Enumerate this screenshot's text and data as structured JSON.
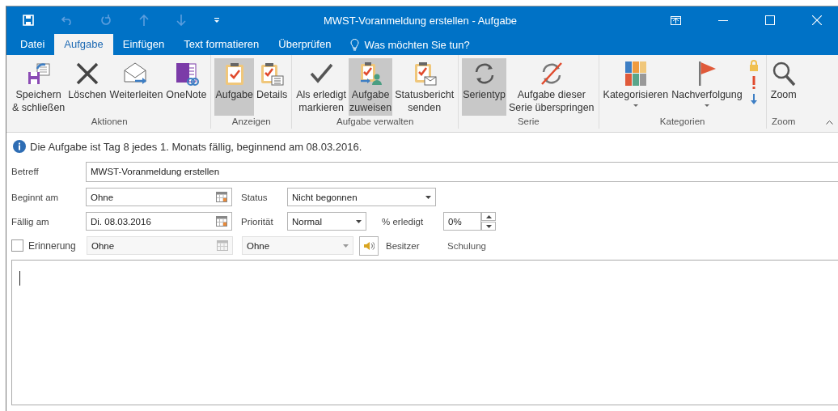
{
  "window": {
    "title": "MWST-Voranmeldung erstellen - Aufgabe"
  },
  "tabs": [
    {
      "label": "Datei",
      "selected": false
    },
    {
      "label": "Aufgabe",
      "selected": true
    },
    {
      "label": "Einfügen",
      "selected": false
    },
    {
      "label": "Text formatieren",
      "selected": false
    },
    {
      "label": "Überprüfen",
      "selected": false
    }
  ],
  "tell_me": "Was möchten Sie tun?",
  "ribbon": {
    "groups": [
      {
        "label": "Aktionen",
        "buttons": [
          {
            "lines": [
              "Speichern",
              "& schließen"
            ],
            "selected": false
          },
          {
            "lines": [
              "Löschen"
            ],
            "selected": false
          },
          {
            "lines": [
              "Weiterleiten"
            ],
            "selected": false
          },
          {
            "lines": [
              "OneNote"
            ],
            "selected": false
          }
        ]
      },
      {
        "label": "Anzeigen",
        "buttons": [
          {
            "lines": [
              "Aufgabe"
            ],
            "selected": true
          },
          {
            "lines": [
              "Details"
            ],
            "selected": false
          }
        ]
      },
      {
        "label": "Aufgabe verwalten",
        "buttons": [
          {
            "lines": [
              "Als erledigt",
              "markieren"
            ],
            "selected": false
          },
          {
            "lines": [
              "Aufgabe",
              "zuweisen"
            ],
            "selected": true
          },
          {
            "lines": [
              "Statusbericht",
              "senden"
            ],
            "selected": false
          }
        ]
      },
      {
        "label": "Serie",
        "buttons": [
          {
            "lines": [
              "Serientyp"
            ],
            "selected": true
          },
          {
            "lines": [
              "Aufgabe dieser",
              "Serie überspringen"
            ],
            "selected": false
          }
        ]
      },
      {
        "label": "Kategorien",
        "buttons": [
          {
            "lines": [
              "Kategorisieren"
            ],
            "selected": false,
            "dropdown": true
          },
          {
            "lines": [
              "Nachverfolgung"
            ],
            "selected": false,
            "dropdown": true
          }
        ]
      },
      {
        "label": "Zoom",
        "buttons": [
          {
            "lines": [
              "Zoom"
            ],
            "selected": false
          }
        ]
      }
    ]
  },
  "info": "Die Aufgabe ist Tag 8 jedes 1. Monats fällig, beginnend am 08.03.2016.",
  "form": {
    "subject": {
      "label": "Betreff",
      "value": "MWST-Voranmeldung erstellen"
    },
    "start": {
      "label": "Beginnt am",
      "value": "Ohne"
    },
    "status": {
      "label": "Status",
      "value": "Nicht begonnen"
    },
    "due": {
      "label": "Fällig am",
      "value": "Di. 08.03.2016"
    },
    "priority": {
      "label": "Priorität",
      "value": "Normal"
    },
    "percent": {
      "label": "% erledigt",
      "value": "0%"
    },
    "reminder": {
      "label": "Erinnerung",
      "checked": false,
      "date": "Ohne",
      "time": "Ohne",
      "disabled": true
    },
    "owner": {
      "label": "Besitzer",
      "value": "Schulung"
    }
  }
}
